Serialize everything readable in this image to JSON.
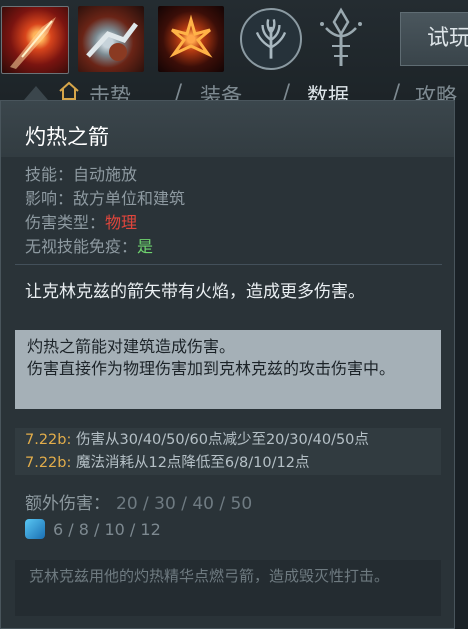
{
  "top_bar": {
    "abilities": [
      {
        "icon": "searing-arrows-icon"
      },
      {
        "icon": "skeleton-walk-icon"
      },
      {
        "icon": "burning-army-icon"
      }
    ],
    "talent_icon": "talent-tree-icon",
    "scepter_icon": "aghanims-scepter-icon",
    "try_button_label": "试玩",
    "nav": {
      "home_icon": "home-icon",
      "items": [
        "击势",
        "装备",
        "数据",
        "攻略"
      ],
      "separator": "/",
      "active": "数据"
    }
  },
  "tooltip": {
    "title": "灼热之箭",
    "attributes": {
      "ability_label": "技能：",
      "ability_value": "自动施放",
      "affects_label": "影响：",
      "affects_value": "敌方单位和建筑",
      "damage_type_label": "伤害类型：",
      "damage_type_value": "物理",
      "pierce_label": "无视技能免疫：",
      "pierce_value": "是"
    },
    "description": "让克林克兹的箭矢带有火焰，造成更多伤害。",
    "note_line1": "灼热之箭能对建筑造成伤害。",
    "note_line2": "伤害直接作为物理伤害加到克林克兹的攻击伤害中。",
    "patch_notes": [
      {
        "version": "7.22b:",
        "text": " 伤害从30/40/50/60点减少至20/30/40/50点"
      },
      {
        "version": "7.22b:",
        "text": " 魔法消耗从12点降低至6/8/10/12点"
      }
    ],
    "extra_damage_label": "额外伤害：",
    "extra_damage_values": "20 / 30 / 40 / 50",
    "mana_icon": "mana-cost-icon",
    "mana_cost": "6 / 8 / 10 / 12",
    "lore": "克林克兹用他的灼热精华点燃弓箭，造成毁灭性打击。"
  },
  "colors": {
    "damage_type_physical": "#e0463c",
    "pierce_yes": "#6fd36f",
    "patch_version": "#e2ad4b",
    "mana": "#3aa0df"
  }
}
